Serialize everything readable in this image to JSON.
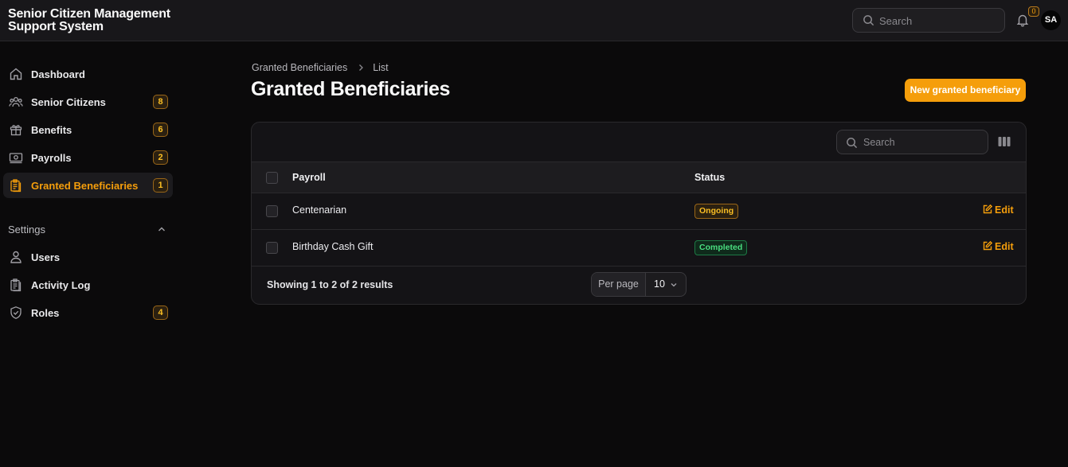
{
  "app": {
    "title": "Senior Citizen Management Support System"
  },
  "header": {
    "search_placeholder": "Search",
    "notifications_count": "0",
    "user_initials": "SA"
  },
  "sidebar": {
    "items": [
      {
        "label": "Dashboard",
        "icon": "home-icon",
        "badge": ""
      },
      {
        "label": "Senior Citizens",
        "icon": "users-icon",
        "badge": "8"
      },
      {
        "label": "Benefits",
        "icon": "gift-icon",
        "badge": "6"
      },
      {
        "label": "Payrolls",
        "icon": "banknote-icon",
        "badge": "2"
      },
      {
        "label": "Granted Beneficiaries",
        "icon": "clipboard-icon",
        "badge": "1",
        "active": true
      }
    ],
    "settings": {
      "label": "Settings",
      "items": [
        {
          "label": "Users",
          "icon": "user-icon",
          "badge": ""
        },
        {
          "label": "Activity Log",
          "icon": "clipboard-list-icon",
          "badge": ""
        },
        {
          "label": "Roles",
          "icon": "shield-check-icon",
          "badge": "4"
        }
      ]
    }
  },
  "breadcrumb": {
    "parent": "Granted Beneficiaries",
    "current": "List"
  },
  "page": {
    "title": "Granted Beneficiaries",
    "new_button": "New granted beneficiary"
  },
  "table": {
    "search_placeholder": "Search",
    "columns": [
      "Payroll",
      "Status"
    ],
    "rows": [
      {
        "payroll": "Centenarian",
        "status": "Ongoing",
        "action": "Edit"
      },
      {
        "payroll": "Birthday Cash Gift",
        "status": "Completed",
        "action": "Edit"
      }
    ],
    "footer": {
      "summary": "Showing 1 to 2 of 2 results",
      "per_page_label": "Per page",
      "per_page_value": "10"
    }
  },
  "colors": {
    "accent": "#f59e0b",
    "success": "#4ade80",
    "background": "#0b0a0b"
  }
}
